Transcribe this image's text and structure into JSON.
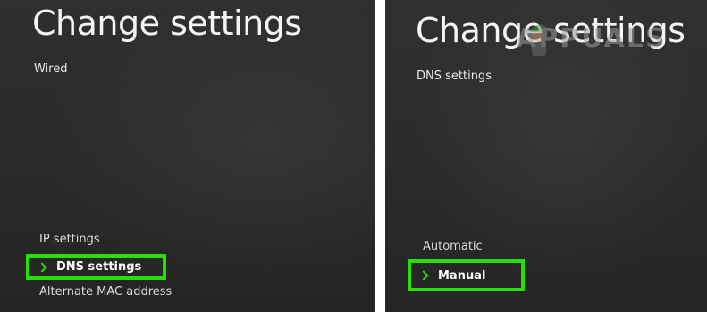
{
  "left_screen": {
    "title": "Change settings",
    "subtitle": "Wired",
    "menu": {
      "ip_settings": "IP settings",
      "dns_settings": "DNS settings",
      "mac_address": "Alternate MAC address"
    },
    "selected": "DNS settings"
  },
  "right_screen": {
    "title": "Change settings",
    "subtitle": "DNS settings",
    "menu": {
      "automatic": "Automatic",
      "manual": "Manual"
    },
    "selected": "Manual"
  },
  "watermark": {
    "text": "APPUALS",
    "icon": "appuals-mascot-icon"
  },
  "colors": {
    "highlight": "#25e000",
    "background": "#2b2b2b",
    "text": "#f2f2f2"
  }
}
